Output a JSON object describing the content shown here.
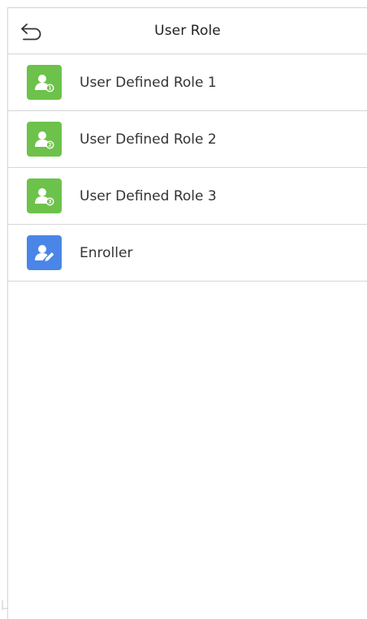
{
  "header": {
    "title": "User Role",
    "back_icon": "back-arrow-icon"
  },
  "colors": {
    "role_icon_bg": "#6cc24a",
    "enroller_icon_bg": "#4a86e8",
    "divider": "#d6d6d6"
  },
  "roles": [
    {
      "label": "User Defined Role 1",
      "icon": "user-role-1-icon",
      "badge": "1"
    },
    {
      "label": "User Defined Role 2",
      "icon": "user-role-2-icon",
      "badge": "2"
    },
    {
      "label": "User Defined Role 3",
      "icon": "user-role-3-icon",
      "badge": "3"
    },
    {
      "label": "Enroller",
      "icon": "enroller-icon"
    }
  ]
}
